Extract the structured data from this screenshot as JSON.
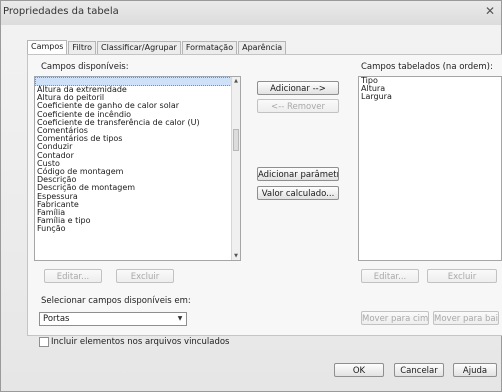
{
  "window": {
    "title": "Propriedades da tabela"
  },
  "tabs": [
    {
      "label": "Campos"
    },
    {
      "label": "Filtro"
    },
    {
      "label": "Classificar/Agrupar"
    },
    {
      "label": "Formatação"
    },
    {
      "label": "Aparência"
    }
  ],
  "available": {
    "label": "Campos disponíveis:",
    "items": [
      "",
      "Altura da extremidade",
      "Altura do peitoril",
      "Coeficiente de ganho de calor solar",
      "Coeficiente de incêndio",
      "Coeficiente de transferência de calor (U)",
      "Comentários",
      "Comentários de tipos",
      "Conduzir",
      "Contador",
      "Custo",
      "Código de montagem",
      "Descrição",
      "Descrição de montagem",
      "Espessura",
      "Fabricante",
      "Família",
      "Família e tipo",
      "Função"
    ]
  },
  "middle_buttons": {
    "add": "Adicionar -->",
    "remove": "<-- Remover",
    "add_param": "Adicionar parâmetro...",
    "calc_value": "Valor calculado..."
  },
  "scheduled": {
    "label": "Campos tabelados (na ordem):",
    "items": [
      "Tipo",
      "Altura",
      "Largura"
    ]
  },
  "left_edit_buttons": {
    "edit": "Editar...",
    "delete": "Excluir"
  },
  "right_edit_buttons": {
    "edit": "Editar...",
    "delete": "Excluir"
  },
  "select_from": {
    "label": "Selecionar campos disponíveis em:",
    "value": "Portas"
  },
  "move_buttons": {
    "up": "Mover para cima",
    "down": "Mover para baixo"
  },
  "linked": {
    "label": "Incluir elementos nos arquivos vinculados"
  },
  "footer": {
    "ok": "OK",
    "cancel": "Cancelar",
    "help": "Ajuda"
  }
}
